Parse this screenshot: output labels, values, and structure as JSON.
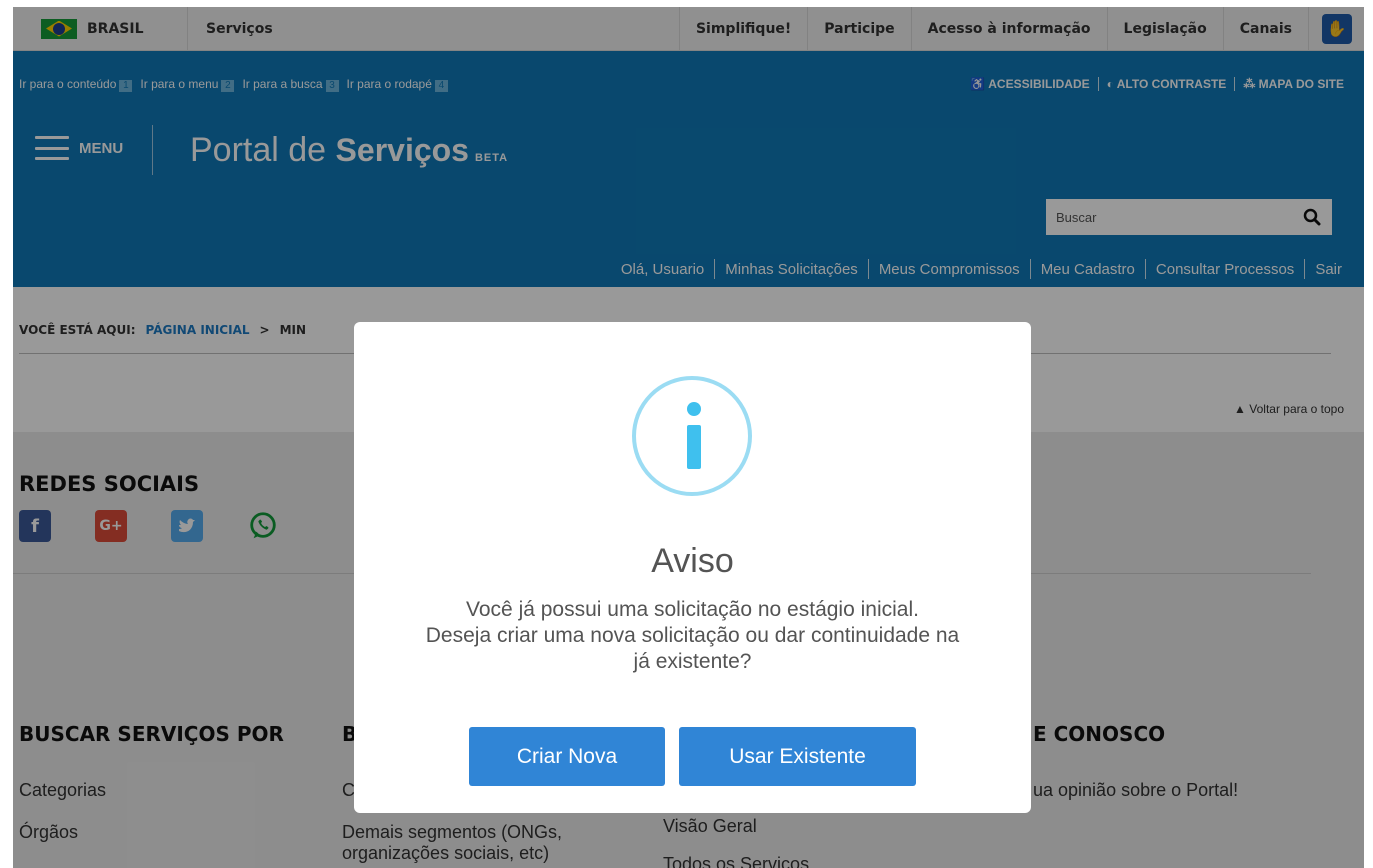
{
  "govbar": {
    "country": "BRASIL",
    "services": "Serviços",
    "items": [
      "Simplifique!",
      "Participe",
      "Acesso à informação",
      "Legislação",
      "Canais"
    ]
  },
  "header": {
    "skiplinks": [
      {
        "label": "Ir para o conteúdo",
        "num": "1"
      },
      {
        "label": "Ir para o menu",
        "num": "2"
      },
      {
        "label": "Ir para a busca",
        "num": "3"
      },
      {
        "label": "Ir para o rodapé",
        "num": "4"
      }
    ],
    "accessibility": "ACESSIBILIDADE",
    "contrast": "ALTO CONTRASTE",
    "sitemap": "MAPA DO SITE",
    "menu_label": "MENU",
    "title_light": "Portal de",
    "title_bold": "Serviços",
    "title_badge": "BETA",
    "search_placeholder": "Buscar",
    "user_links": [
      "Olá, Usuario",
      "Minhas Solicitações",
      "Meus Compromissos",
      "Meu Cadastro",
      "Consultar Processos",
      "Sair"
    ]
  },
  "content": {
    "breadcrumb_prefix": "VOCÊ ESTÁ AQUI:",
    "breadcrumb_home": "PÁGINA INICIAL",
    "breadcrumb_sep": ">",
    "breadcrumb_current": "MIN",
    "back_to_top": "▲ Voltar para o topo"
  },
  "footer": {
    "social_title": "REDES SOCIAIS",
    "col1_title": "BUSCAR SERVIÇOS POR",
    "col1_links": [
      "Categorias",
      "Órgãos"
    ],
    "col2_title": "B",
    "col2_links": [
      "C",
      "Demais segmentos (ONGs,",
      "organizações sociais, etc)"
    ],
    "col3_links": [
      "Visão Geral",
      "Todos os Serviços"
    ],
    "col4_title": "E CONOSCO",
    "col4_link": "ua opinião sobre o Portal!"
  },
  "modal": {
    "title": "Aviso",
    "message_line1": "Você já possui uma solicitação no estágio inicial.",
    "message_line2": "Deseja criar uma nova solicitação ou dar continuidade na",
    "message_line3": "já existente?",
    "btn_new": "Criar Nova",
    "btn_existing": "Usar Existente"
  },
  "colors": {
    "header_blue": "#0f79b8",
    "button_blue": "#3085d6",
    "info_icon": "#3fc0ee"
  }
}
